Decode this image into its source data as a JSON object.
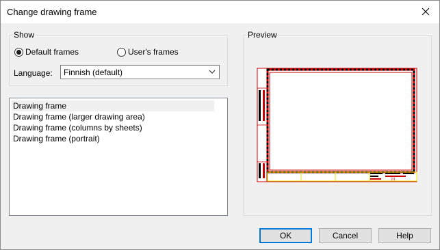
{
  "dialog": {
    "title": "Change drawing frame"
  },
  "show": {
    "legend": "Show",
    "options": [
      {
        "label": "Default frames",
        "selected": true
      },
      {
        "label": "User's frames",
        "selected": false
      }
    ],
    "language_label": "Language:",
    "language_value": "Finnish (default)"
  },
  "frames": {
    "items": [
      {
        "label": "Drawing frame",
        "selected": true
      },
      {
        "label": "Drawing frame (larger drawing area)",
        "selected": false
      },
      {
        "label": "Drawing frame (columns by sheets)",
        "selected": false
      },
      {
        "label": "Drawing frame (portrait)",
        "selected": false
      }
    ]
  },
  "preview": {
    "legend": "Preview",
    "title_block_text": "2/1"
  },
  "buttons": {
    "ok": "OK",
    "cancel": "Cancel",
    "help": "Help"
  },
  "icons": {
    "close": "close-icon",
    "dropdown": "chevron-down-icon",
    "radio_checked": "radio-checked-icon",
    "radio_unchecked": "radio-unchecked-icon"
  },
  "colors": {
    "focus_border": "#0078d7",
    "frame_red": "#cc0000",
    "frame_yellow": "#e8e800"
  }
}
